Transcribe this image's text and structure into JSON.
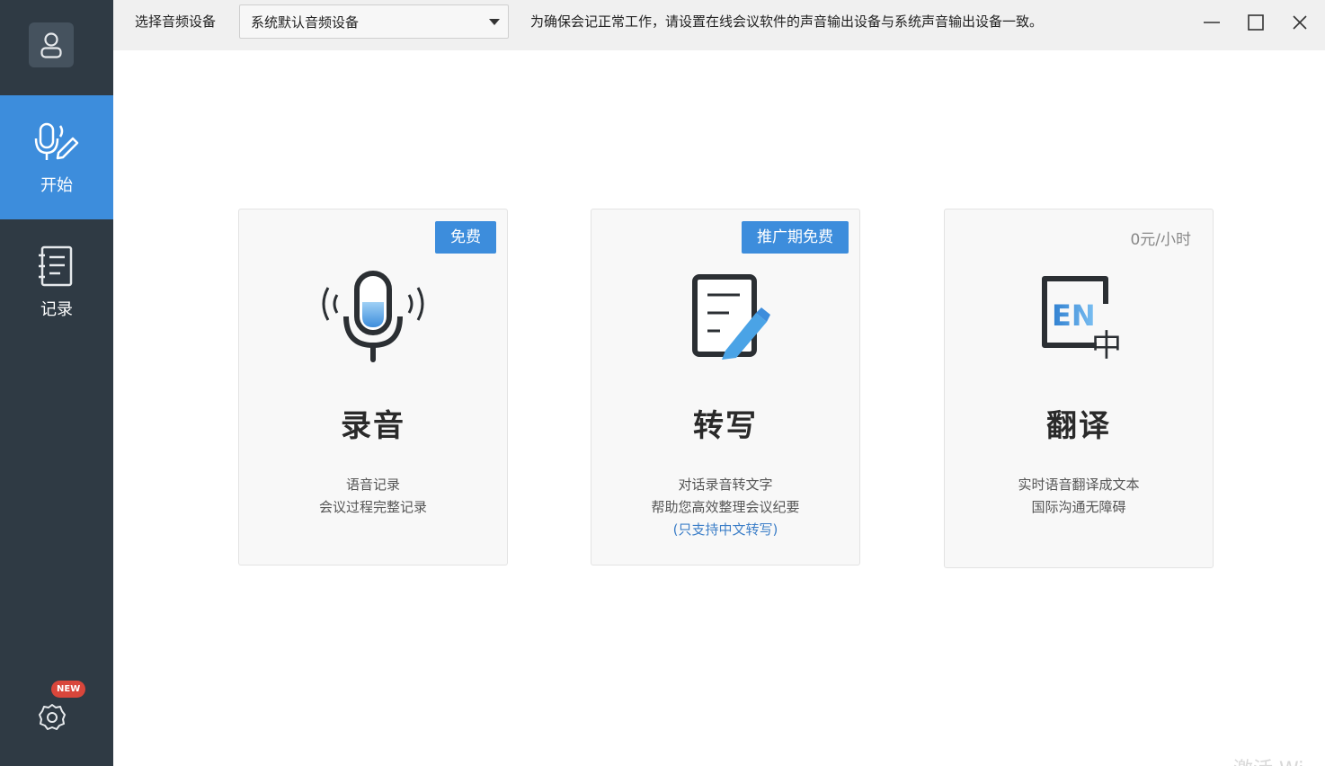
{
  "sidebar": {
    "avatar_icon": "user-icon",
    "nav": [
      {
        "label": "开始",
        "icon": "mic-pen-icon",
        "active": true
      },
      {
        "label": "记录",
        "icon": "notebook-icon",
        "active": false
      }
    ],
    "settings_icon": "gear-icon",
    "settings_badge": "NEW"
  },
  "topbar": {
    "device_label": "选择音频设备",
    "device_value": "系统默认音频设备",
    "notice": "为确保会记正常工作，请设置在线会议软件的声音输出设备与系统声音输出设备一致。"
  },
  "cards": [
    {
      "tag": "免费",
      "title": "录音",
      "desc1": "语音记录",
      "desc2": "会议过程完整记录",
      "icon": "microphone-icon"
    },
    {
      "tag": "推广期免费",
      "title": "转写",
      "desc1": "对话录音转文字",
      "desc2": "帮助您高效整理会议纪要",
      "note": "(只支持中文转写)",
      "icon": "document-pen-icon"
    },
    {
      "price": "0元/小时",
      "title": "翻译",
      "desc1": "实时语音翻译成文本",
      "desc2": "国际沟通无障碍",
      "icon": "translate-en-zh-icon",
      "icon_text_en": "EN",
      "icon_text_zh": "中"
    }
  ],
  "watermark": "激活 Wi",
  "colors": {
    "sidebar": "#2f3a44",
    "accent": "#3d8ddc",
    "badge": "#d9463b"
  }
}
